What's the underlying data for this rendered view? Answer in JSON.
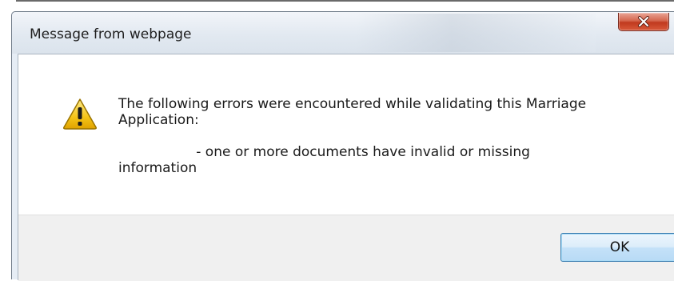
{
  "dialog": {
    "title": "Message from webpage",
    "close_icon": "close-icon",
    "warning_icon": "warning-icon",
    "message_line1": "The following errors were encountered while validating this Marriage",
    "message_line2": "Application:",
    "message_line3": "                  - one or more documents have invalid or missing",
    "message_line4": "information",
    "ok_label": "OK"
  },
  "colors": {
    "close_button": "#c94a2e",
    "ok_button_border": "#3c7fb1",
    "warning_fill": "#f5c518"
  }
}
